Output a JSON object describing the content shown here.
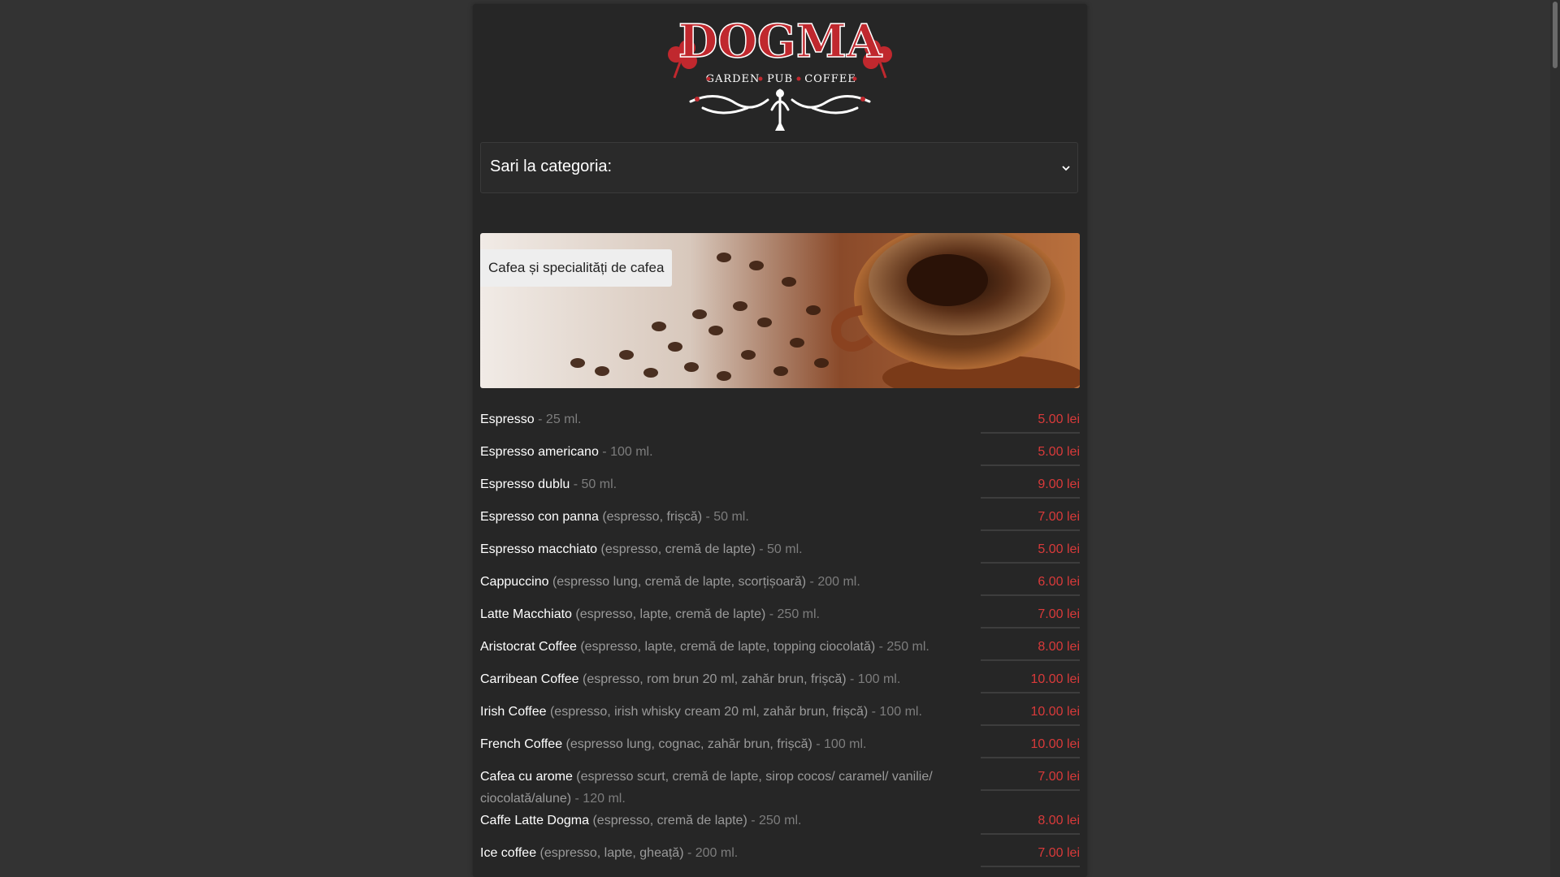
{
  "logo": {
    "name": "DOGMA",
    "tagline_1": "GARDEN",
    "tagline_2": "PUB",
    "tagline_3": "COFFEE",
    "color": "#c0282e"
  },
  "category_select": {
    "label": "Sari la categoria:",
    "icon": "chevron-down-icon"
  },
  "banner": {
    "title": "Cafea și specialități de cafea"
  },
  "menu": {
    "items": [
      {
        "name": "Espresso",
        "desc": "",
        "volume": " - 25 ml.",
        "price": "5.00 lei"
      },
      {
        "name": "Espresso americano",
        "desc": "",
        "volume": " - 100 ml.",
        "price": "5.00 lei"
      },
      {
        "name": "Espresso dublu",
        "desc": "",
        "volume": " - 50 ml.",
        "price": "9.00 lei"
      },
      {
        "name": "Espresso con panna",
        "desc": " (espresso, frișcă)",
        "volume": " - 50 ml.",
        "price": "7.00 lei"
      },
      {
        "name": "Espresso macchiato",
        "desc": " (espresso, cremă de lapte)",
        "volume": " - 50 ml.",
        "price": "5.00 lei"
      },
      {
        "name": "Cappuccino",
        "desc": " (espresso lung, cremă de lapte, scorțișoară)",
        "volume": " - 200 ml.",
        "price": "6.00 lei"
      },
      {
        "name": "Latte Macchiato",
        "desc": " (espresso, lapte, cremă de lapte)",
        "volume": " - 250 ml.",
        "price": "7.00 lei"
      },
      {
        "name": "Aristocrat Coffee",
        "desc": " (espresso, lapte, cremă de lapte, topping ciocolată)",
        "volume": " - 250 ml.",
        "price": "8.00 lei"
      },
      {
        "name": "Carribean Coffee",
        "desc": " (espresso, rom brun 20 ml, zahăr brun, frișcă)",
        "volume": " - 100 ml.",
        "price": "10.00 lei"
      },
      {
        "name": "Irish Coffee",
        "desc": " (espresso, irish whisky cream 20 ml, zahăr brun, frișcă)",
        "volume": " - 100 ml.",
        "price": "10.00 lei"
      },
      {
        "name": "French Coffee",
        "desc": " (espresso lung, cognac, zahăr brun, frișcă)",
        "volume": " - 100 ml.",
        "price": "10.00 lei"
      },
      {
        "name": "Cafea cu arome",
        "desc": " (espresso scurt, cremă de lapte, sirop cocos/ caramel/ vanilie/ ciocolată/alune)",
        "volume": " - 120 ml.",
        "price": "7.00 lei"
      },
      {
        "name": "Caffe Latte Dogma",
        "desc": " (espresso, cremă de lapte)",
        "volume": " - 250 ml.",
        "price": "8.00 lei"
      },
      {
        "name": "Ice coffee",
        "desc": " (espresso, lapte, gheață)",
        "volume": " - 200 ml.",
        "price": "7.00 lei"
      }
    ]
  },
  "colors": {
    "background": "#333333",
    "panel": "#262626",
    "price": "#d93a3a"
  }
}
